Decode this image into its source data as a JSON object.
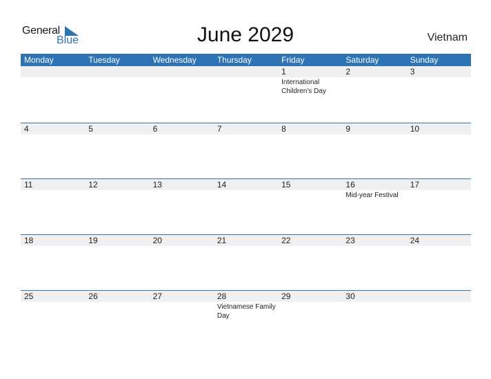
{
  "logo": {
    "general": "General",
    "blue": "Blue"
  },
  "title": "June 2029",
  "country": "Vietnam",
  "colors": {
    "accent": "#2e74b5",
    "date_strip": "#f0f0f0"
  },
  "weekdays": [
    "Monday",
    "Tuesday",
    "Wednesday",
    "Thursday",
    "Friday",
    "Saturday",
    "Sunday"
  ],
  "weeks": [
    [
      {
        "d": ""
      },
      {
        "d": ""
      },
      {
        "d": ""
      },
      {
        "d": ""
      },
      {
        "d": "1",
        "e": "International Children's Day"
      },
      {
        "d": "2"
      },
      {
        "d": "3"
      }
    ],
    [
      {
        "d": "4"
      },
      {
        "d": "5"
      },
      {
        "d": "6"
      },
      {
        "d": "7"
      },
      {
        "d": "8"
      },
      {
        "d": "9"
      },
      {
        "d": "10"
      }
    ],
    [
      {
        "d": "11"
      },
      {
        "d": "12"
      },
      {
        "d": "13"
      },
      {
        "d": "14"
      },
      {
        "d": "15"
      },
      {
        "d": "16",
        "e": "Mid-year Festival"
      },
      {
        "d": "17"
      }
    ],
    [
      {
        "d": "18"
      },
      {
        "d": "19"
      },
      {
        "d": "20"
      },
      {
        "d": "21"
      },
      {
        "d": "22"
      },
      {
        "d": "23"
      },
      {
        "d": "24"
      }
    ],
    [
      {
        "d": "25"
      },
      {
        "d": "26"
      },
      {
        "d": "27"
      },
      {
        "d": "28",
        "e": "Vietnamese Family Day"
      },
      {
        "d": "29"
      },
      {
        "d": "30"
      },
      {
        "d": ""
      }
    ]
  ]
}
